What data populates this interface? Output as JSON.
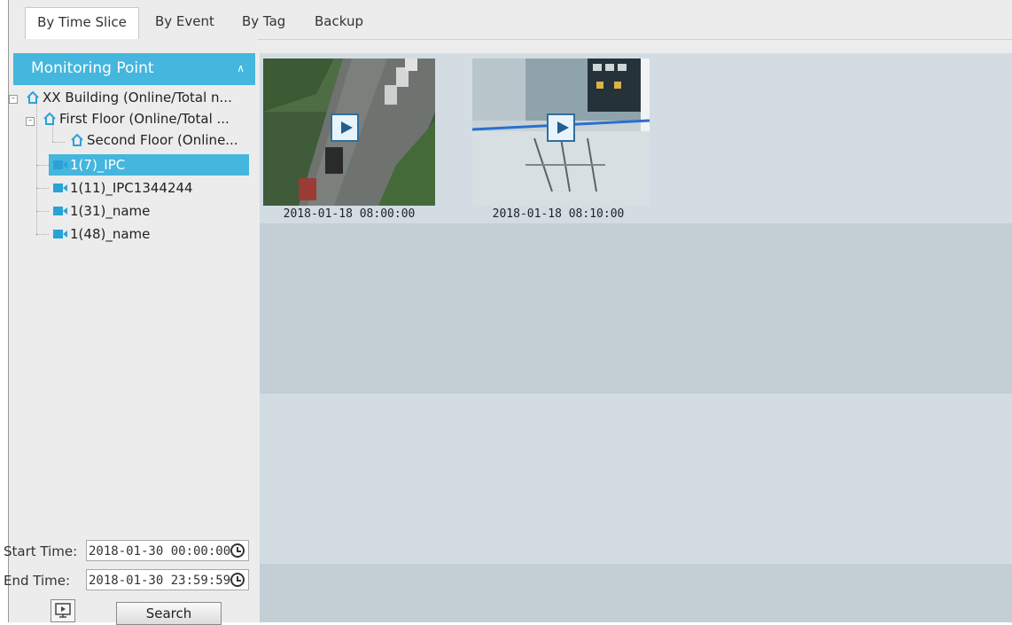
{
  "tabs": [
    {
      "label": "By Time Slice",
      "active": true
    },
    {
      "label": "By Event",
      "active": false
    },
    {
      "label": "By Tag",
      "active": false
    },
    {
      "label": "Backup",
      "active": false
    }
  ],
  "sidebar": {
    "header": "Monitoring Point",
    "tree": [
      {
        "label": "XX Building (Online/Total n...",
        "type": "area"
      },
      {
        "label": "First Floor (Online/Total ...",
        "type": "area"
      },
      {
        "label": "Second Floor (Online...",
        "type": "area"
      },
      {
        "label": "1(7)_IPC",
        "type": "camera",
        "selected": true
      },
      {
        "label": "1(11)_IPC1344244",
        "type": "camera"
      },
      {
        "label": "1(31)_name",
        "type": "camera"
      },
      {
        "label": "1(48)_name",
        "type": "camera"
      }
    ],
    "start_time_label": "Start Time:",
    "start_time_value": "2018-01-30 00:00:00",
    "end_time_label": "End Time:",
    "end_time_value": "2018-01-30 23:59:59",
    "search_label": "Search"
  },
  "results": [
    {
      "timestamp": "2018-01-18 08:00:00",
      "scene": "street-aerial"
    },
    {
      "timestamp": "2018-01-18 08:10:00",
      "scene": "office-lobby"
    }
  ],
  "colors": {
    "accent": "#45b6dd",
    "band_light": "#d3dce3",
    "band_dark": "#c2ccd3"
  }
}
